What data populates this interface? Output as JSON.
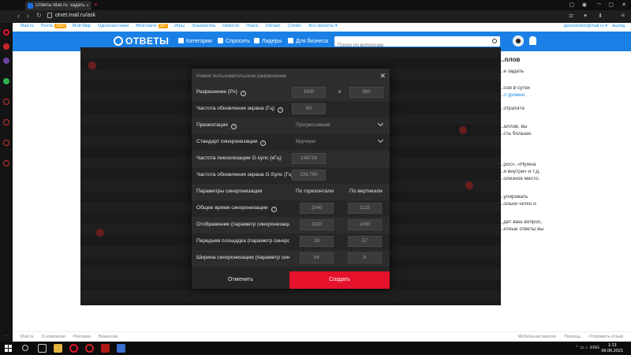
{
  "browser": {
    "tab_title": "Ответы Mail.ru: задать во...",
    "url": "otvet.mail.ru/ask",
    "accent": "#e4122a"
  },
  "portal": {
    "links": [
      "Mail.ru",
      "Почта",
      "Мой Мир",
      "Одноклассники",
      "ВКонтакте",
      "Игры",
      "Знакомства",
      "Новости",
      "Поиск",
      "Облако",
      "Combo",
      "Все проекты ▾"
    ],
    "mail_badge": "1000",
    "vk_badge": "367",
    "user": "gameandrei@mail.ru ▾",
    "exit": "выход"
  },
  "header": {
    "logo": "ОТВЕТЫ",
    "nav": [
      "Категории",
      "Спросить",
      "Лидеры",
      "Для бизнеса"
    ],
    "search_placeholder": "Поиск по вопросам",
    "brand_color": "#1a80e5"
  },
  "right_side": {
    "heading": "...плов",
    "lines": [
      "...е задать",
      "...сов в сутки",
      "...о уровня.",
      "...отратите",
      "...аллов, вы",
      "...сть больше.",
      "...рос», «Нужна",
      "...и внутри» и т.д.",
      "...олезное место.",
      "...улировать",
      "...ольно четко и",
      "...дет ваш вопрос,",
      "...етные ответы вы"
    ]
  },
  "footer": {
    "left": [
      "Mail.ru",
      "О компании",
      "Реклама",
      "Вакансии"
    ],
    "right": [
      "Мобильная версия",
      "Помощь",
      "Отправить отзыв"
    ]
  },
  "dialog": {
    "title": "Новое пользовательское разрешение",
    "rows": {
      "resolution": {
        "label": "Разрешение (Px)",
        "w": "1600",
        "sep": "x",
        "h": "900"
      },
      "refresh": {
        "label": "Частота обновления экрана (Гц)",
        "value": "60"
      },
      "presentation": {
        "label": "Презентация",
        "value": "Прогрессивная"
      },
      "sync_standard": {
        "label": "Стандарт синхронизации",
        "value": "Вручную"
      },
      "pixel_clock": {
        "label": "Частота пикселизации G-sync (кГц)",
        "value": "148716"
      },
      "gsync_refresh": {
        "label": "Частота обновления экрана G-Sync (Гц)",
        "value": "239.760"
      },
      "sync_params": {
        "label": "Параметры синхронизации",
        "col_h": "По горизонтали",
        "col_v": "По вертикали"
      },
      "total": {
        "label": "Общее время синхронизации",
        "h": "2040",
        "v": "1215"
      },
      "display": {
        "label": "Отображение (параметр синхронизации)",
        "h": "1920",
        "v": "1080"
      },
      "front_porch": {
        "label": "Передняя площадка (параметр синхронизации)",
        "h": "28",
        "v": "57"
      },
      "sync_width": {
        "label": "Ширина синхронизации (параметр синхронизации)",
        "h": "64",
        "v": "8"
      }
    },
    "cancel": "Отменить",
    "create": "Создать"
  },
  "taskbar": {
    "lang": "ENG",
    "time": "1:13",
    "date": "06.06.2021"
  }
}
